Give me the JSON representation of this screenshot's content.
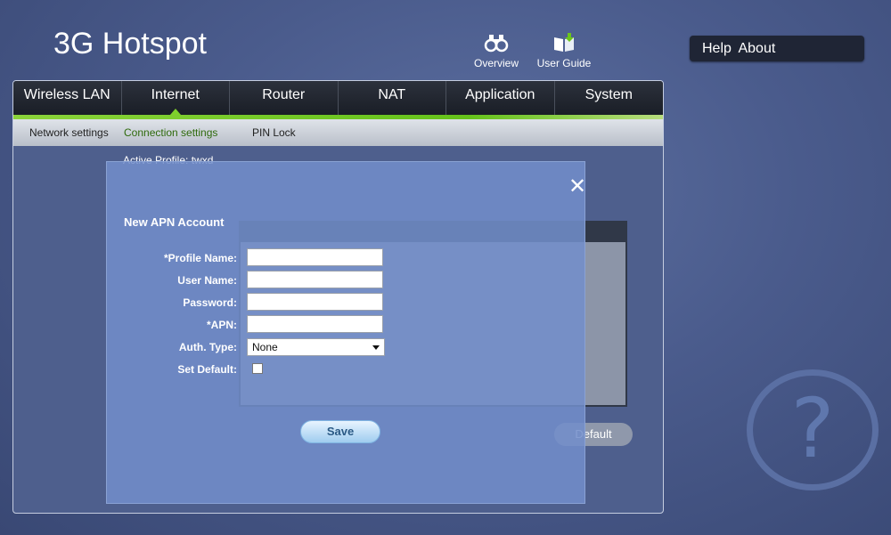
{
  "header": {
    "app_title": "3G Hotspot",
    "overview_label": "Overview",
    "overview_icon": "binoculars-icon",
    "user_guide_label": "User Guide",
    "user_guide_icon": "book-download-icon",
    "help_label": "Help",
    "about_label": "About"
  },
  "tabs": [
    {
      "label": "Wireless LAN"
    },
    {
      "label": "Internet",
      "active": true
    },
    {
      "label": "Router"
    },
    {
      "label": "NAT"
    },
    {
      "label": "Application"
    },
    {
      "label": "System"
    }
  ],
  "subnav": [
    {
      "label": "Network settings"
    },
    {
      "label": "Connection settings",
      "active": true
    },
    {
      "label": "PIN Lock"
    }
  ],
  "background": {
    "active_profile": "Active Profile: twxd",
    "set_default_label": "Default"
  },
  "modal": {
    "title": "New APN Account",
    "profile_name_label": "*Profile Name:",
    "profile_name_value": "",
    "user_name_label": "User Name:",
    "user_name_value": "",
    "password_label": "Password:",
    "password_value": "",
    "apn_label": "*APN:",
    "apn_value": "",
    "auth_type_label": "Auth. Type:",
    "auth_type_value": "None",
    "set_default_label": "Set Default:",
    "set_default_checked": false,
    "save_label": "Save",
    "close_icon": "close-icon"
  },
  "help_widget_glyph": "?",
  "colors": {
    "accent_green": "#7fd12b",
    "tab_bar": "#1f2430",
    "modal_overlay": "#728ecb"
  }
}
